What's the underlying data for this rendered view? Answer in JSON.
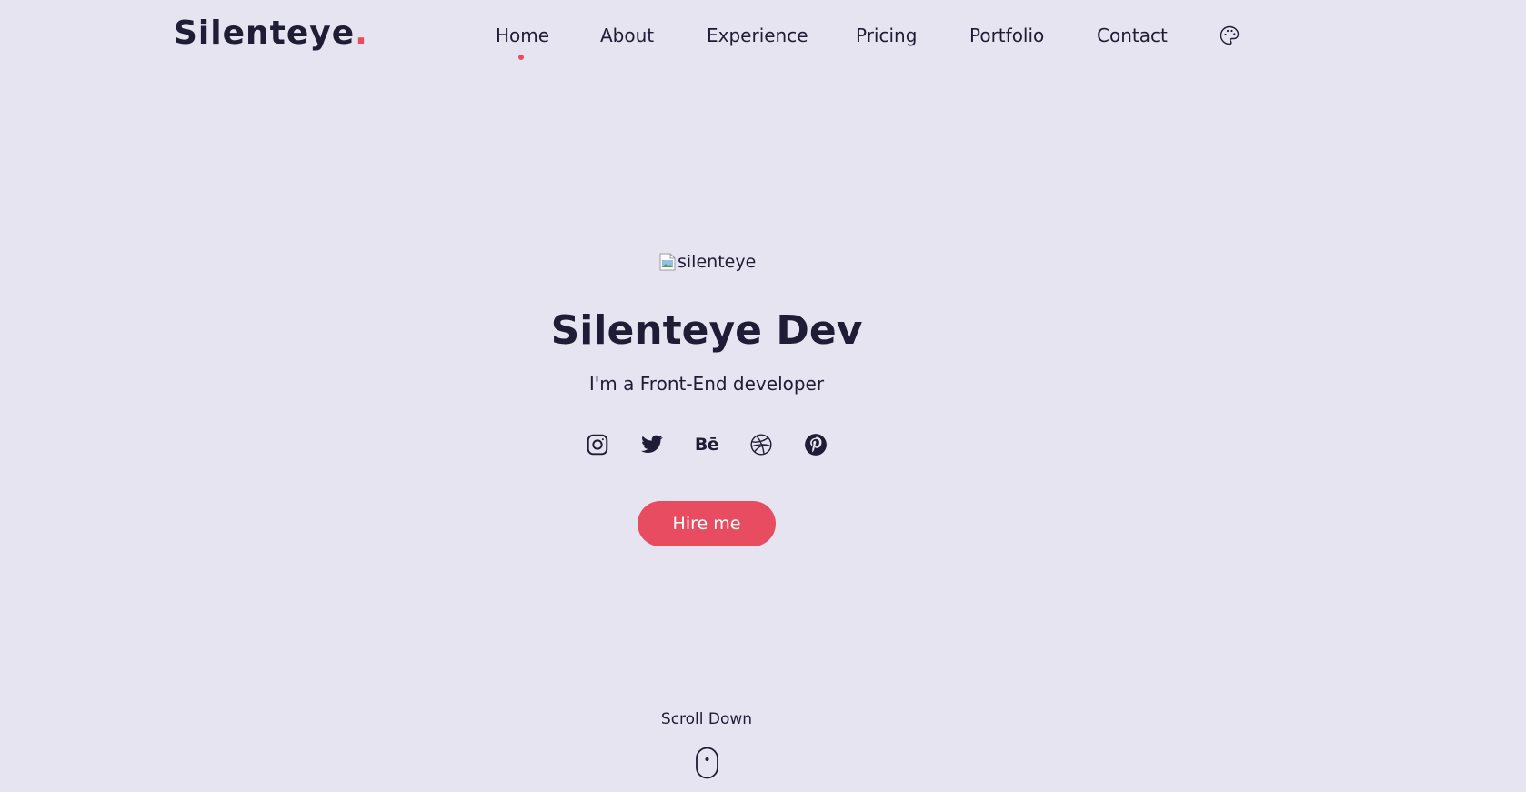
{
  "header": {
    "logo_text": "Silenteye",
    "logo_dot": ".",
    "nav": [
      {
        "label": "Home",
        "active": true
      },
      {
        "label": "About"
      },
      {
        "label": "Experience"
      },
      {
        "label": "Pricing"
      },
      {
        "label": "Portfolio"
      },
      {
        "label": "Contact"
      }
    ],
    "theme_icon": "palette-icon"
  },
  "hero": {
    "avatar_alt": "silenteye",
    "title": "Silenteye Dev",
    "subtitle": "I'm a Front-End developer",
    "socials": [
      {
        "name": "instagram-icon"
      },
      {
        "name": "twitter-icon"
      },
      {
        "name": "behance-icon",
        "text": "Bē"
      },
      {
        "name": "dribbble-icon"
      },
      {
        "name": "pinterest-icon"
      }
    ],
    "cta_label": "Hire me",
    "scroll_label": "Scroll Down",
    "scroll_icon": "mouse-icon"
  },
  "colors": {
    "background": "#e6e4f0",
    "text": "#1f1c36",
    "accent": "#e84c60"
  }
}
